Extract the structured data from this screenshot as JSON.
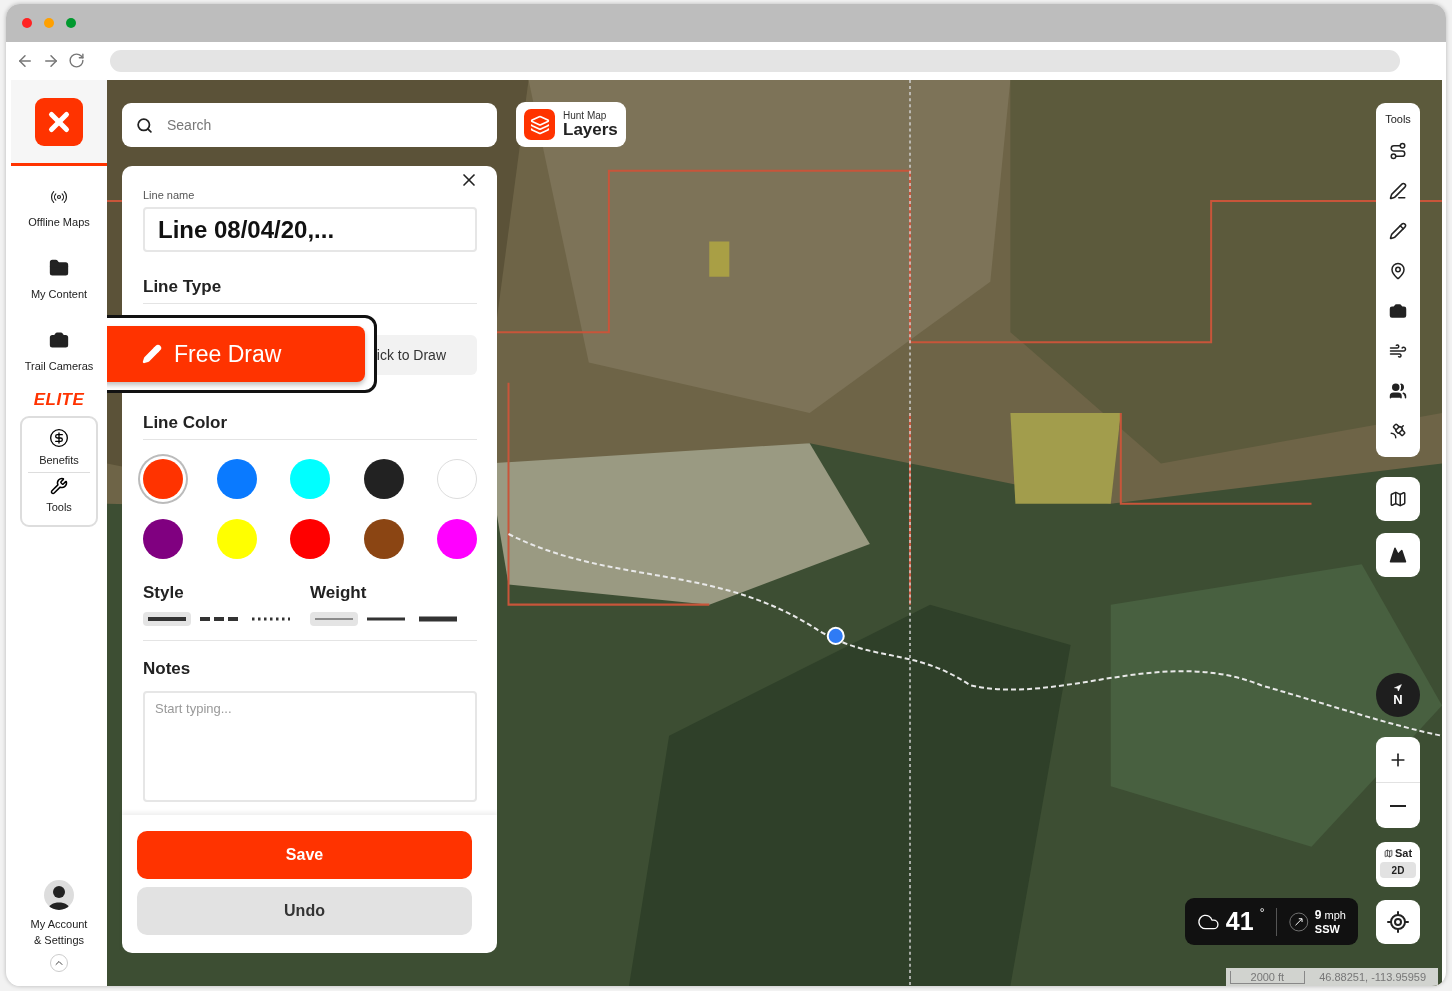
{
  "sidebar": {
    "items": [
      {
        "label": "Offline Maps",
        "kind": "offline"
      },
      {
        "label": "My Content",
        "kind": "content"
      },
      {
        "label": "Trail Cameras",
        "kind": "camera"
      }
    ],
    "elite_label": "ELITE",
    "elite_items": [
      {
        "label": "Benefits",
        "kind": "benefits"
      },
      {
        "label": "Tools",
        "kind": "tools"
      }
    ],
    "account": {
      "label": "My Account & Settings"
    }
  },
  "search": {
    "placeholder": "Search"
  },
  "layers_button": {
    "caption": "Hunt Map",
    "label": "Layers"
  },
  "line_panel": {
    "name_label": "Line name",
    "name_value": "Line 08/04/20,...",
    "line_type_title": "Line Type",
    "line_types": [
      {
        "label": "Free Draw",
        "selected": true
      },
      {
        "label": "ick to Draw",
        "selected": false
      }
    ],
    "color_title": "Line Color",
    "colors": [
      {
        "color": "#ff3300",
        "selected": true
      },
      {
        "color": "#0a7aff",
        "selected": false
      },
      {
        "color": "#00ffff",
        "selected": false
      },
      {
        "color": "#222222",
        "selected": false
      },
      {
        "color": "#ffffff",
        "selected": false
      },
      {
        "color": "#800080",
        "selected": false
      },
      {
        "color": "#ffff00",
        "selected": false
      },
      {
        "color": "#ff0000",
        "selected": false
      },
      {
        "color": "#8b4513",
        "selected": false
      },
      {
        "color": "#ff00ff",
        "selected": false
      }
    ],
    "style_title": "Style",
    "styles": [
      {
        "kind": "solid",
        "selected": true
      },
      {
        "kind": "dashed",
        "selected": false
      },
      {
        "kind": "dotted",
        "selected": false
      }
    ],
    "weight_title": "Weight",
    "weights": [
      {
        "kind": "thin",
        "selected": true
      },
      {
        "kind": "medium",
        "selected": false
      },
      {
        "kind": "thick",
        "selected": false
      }
    ],
    "notes_title": "Notes",
    "notes_placeholder": "Start typing...",
    "save_label": "Save",
    "undo_label": "Undo"
  },
  "tools": {
    "title": "Tools",
    "items": [
      {
        "kind": "route"
      },
      {
        "kind": "line"
      },
      {
        "kind": "area"
      },
      {
        "kind": "pin"
      },
      {
        "kind": "camera"
      },
      {
        "kind": "wind"
      },
      {
        "kind": "people"
      },
      {
        "kind": "satellite"
      }
    ],
    "extra": [
      {
        "kind": "terrain"
      },
      {
        "kind": "mountain"
      }
    ]
  },
  "compass": {
    "label": "N"
  },
  "map_type": {
    "label": "Sat",
    "mode": "2D"
  },
  "weather": {
    "temperature": "41",
    "degree": "°",
    "wind_speed": "9",
    "wind_unit": "mph",
    "wind_direction": "SSW"
  },
  "scale": "2000 ft",
  "coordinates": "46.88251, -113.95959"
}
